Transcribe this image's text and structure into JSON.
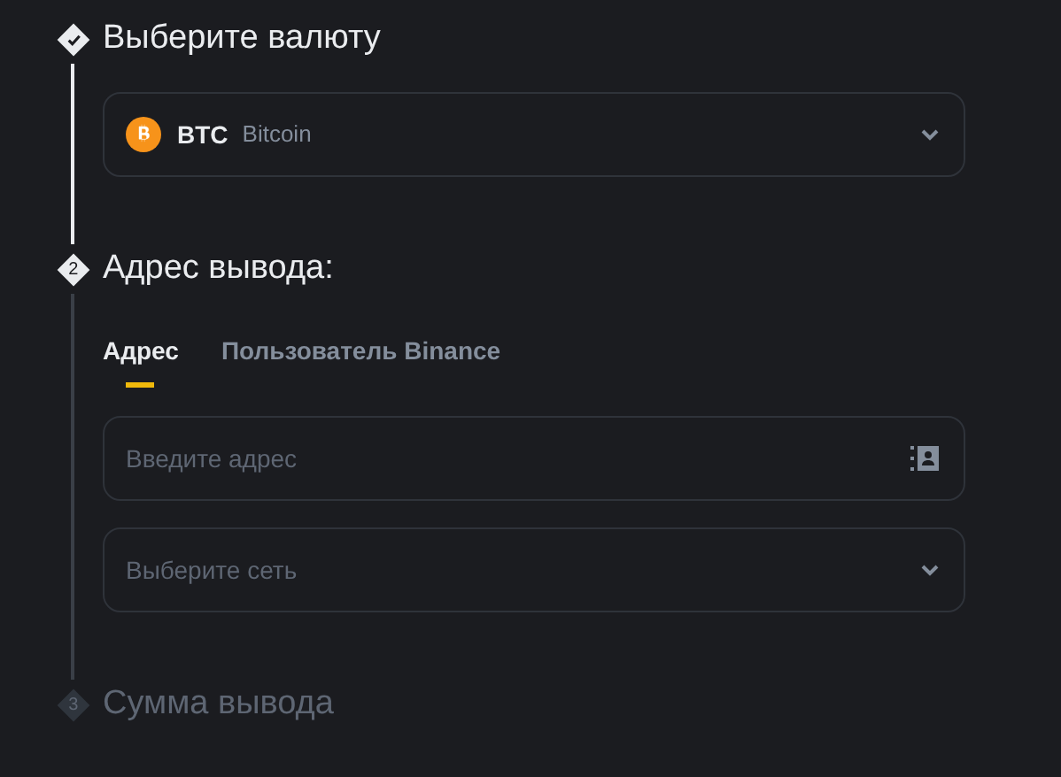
{
  "steps": [
    {
      "completed": true,
      "current": false,
      "title": "Выберите валюту",
      "coin_select": {
        "symbol": "BTC",
        "name": "Bitcoin"
      }
    },
    {
      "completed": false,
      "current": true,
      "number": "2",
      "title": "Адрес вывода:",
      "tabs": [
        {
          "label": "Адрес",
          "selected": true
        },
        {
          "label": "Пользователь Binance",
          "selected": false
        }
      ],
      "fields": [
        {
          "kind": "input",
          "placeholder": "Введите адрес"
        },
        {
          "kind": "select",
          "placeholder": "Выберите сеть"
        }
      ]
    },
    {
      "completed": false,
      "current": false,
      "number": "3",
      "title": "Сумма вывода"
    }
  ]
}
